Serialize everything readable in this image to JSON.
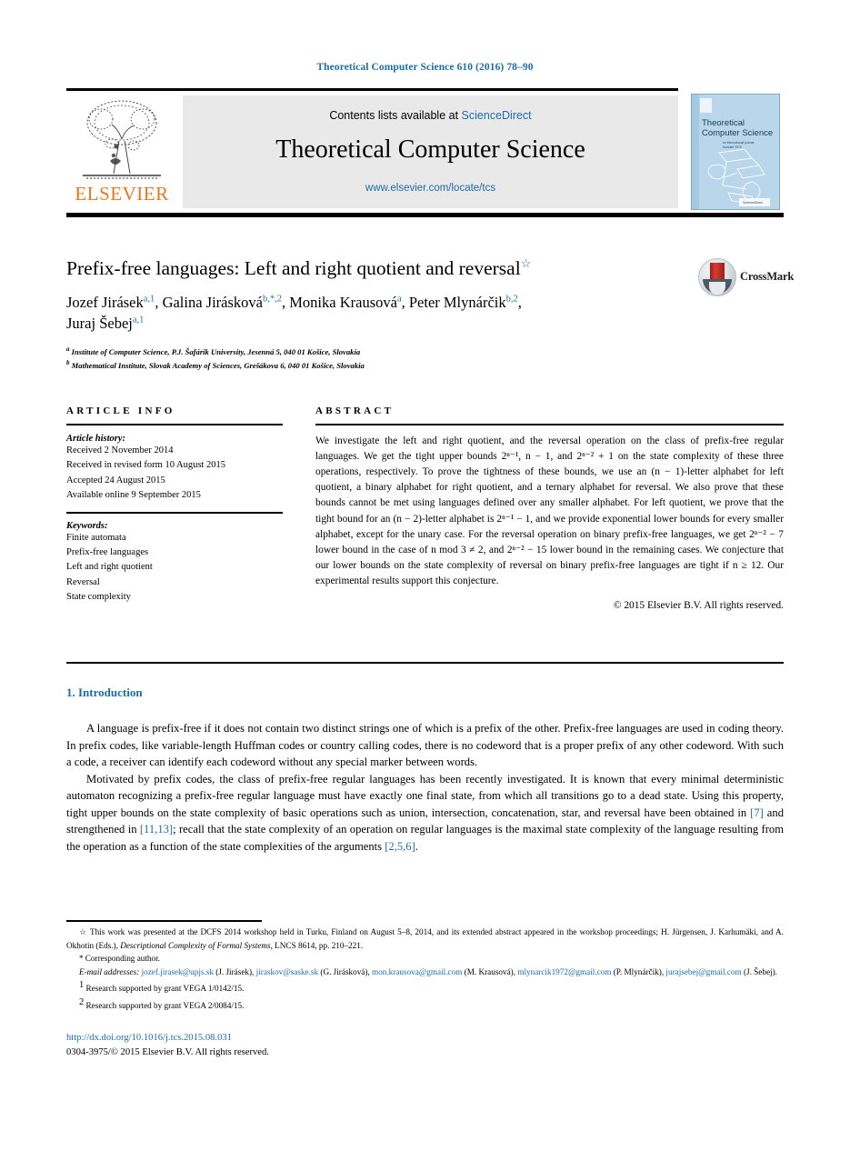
{
  "running_head": "Theoretical Computer Science 610 (2016) 78–90",
  "masthead": {
    "contents_prefix": "Contents lists available at",
    "sciencedirect": "ScienceDirect",
    "journal_title": "Theoretical Computer Science",
    "journal_url": "www.elsevier.com/locate/tcs",
    "publisher": "ELSEVIER",
    "cover_title_line1": "Theoretical",
    "cover_title_line2": "Computer Science"
  },
  "article": {
    "title": "Prefix-free languages: Left and right quotient and reversal",
    "title_star": "☆",
    "crossmark_label": "CrossMark",
    "authors_line1": "Jozef Jirásek",
    "authors": [
      {
        "name": "Jozef Jirásek",
        "sup": "a,1"
      },
      {
        "name": "Galina Jirásková",
        "sup": "b,*,2"
      },
      {
        "name": "Monika Krausová",
        "sup": "a"
      },
      {
        "name": "Peter Mlynárčik",
        "sup": "b,2"
      },
      {
        "name": "Juraj Šebej",
        "sup": "a,1"
      }
    ],
    "affiliations": [
      {
        "marker": "a",
        "text": "Institute of Computer Science, P.J. Šafárik University, Jesenná 5, 040 01 Košice, Slovakia"
      },
      {
        "marker": "b",
        "text": "Mathematical Institute, Slovak Academy of Sciences, Grešákova 6, 040 01 Košice, Slovakia"
      }
    ]
  },
  "article_info": {
    "heading": "ARTICLE INFO",
    "history_heading": "Article history:",
    "history": [
      "Received 2 November 2014",
      "Received in revised form 10 August 2015",
      "Accepted 24 August 2015",
      "Available online 9 September 2015"
    ],
    "keywords_heading": "Keywords:",
    "keywords": [
      "Finite automata",
      "Prefix-free languages",
      "Left and right quotient",
      "Reversal",
      "State complexity"
    ]
  },
  "abstract": {
    "heading": "ABSTRACT",
    "text": "We investigate the left and right quotient, and the reversal operation on the class of prefix-free regular languages. We get the tight upper bounds 2ⁿ⁻¹, n − 1, and 2ⁿ⁻² + 1 on the state complexity of these three operations, respectively. To prove the tightness of these bounds, we use an (n − 1)-letter alphabet for left quotient, a binary alphabet for right quotient, and a ternary alphabet for reversal. We also prove that these bounds cannot be met using languages defined over any smaller alphabet. For left quotient, we prove that the tight bound for an (n − 2)-letter alphabet is 2ⁿ⁻¹ − 1, and we provide exponential lower bounds for every smaller alphabet, except for the unary case. For the reversal operation on binary prefix-free languages, we get 2ⁿ⁻² − 7 lower bound in the case of n mod 3 ≠ 2, and 2ⁿ⁻² − 15 lower bound in the remaining cases. We conjecture that our lower bounds on the state complexity of reversal on binary prefix-free languages are tight if n ≥ 12. Our experimental results support this conjecture.",
    "copyright": "© 2015 Elsevier B.V. All rights reserved."
  },
  "introduction": {
    "number": "1.",
    "heading": "Introduction",
    "paragraph1": "A language is prefix-free if it does not contain two distinct strings one of which is a prefix of the other. Prefix-free languages are used in coding theory. In prefix codes, like variable-length Huffman codes or country calling codes, there is no codeword that is a proper prefix of any other codeword. With such a code, a receiver can identify each codeword without any special marker between words.",
    "paragraph2_part1": "Motivated by prefix codes, the class of prefix-free regular languages has been recently investigated. It is known that every minimal deterministic automaton recognizing a prefix-free regular language must have exactly one final state, from which all transitions go to a dead state. Using this property, tight upper bounds on the state complexity of basic operations such as union, intersection, concatenation, star, and reversal have been obtained in ",
    "ref1": "[7]",
    "paragraph2_part2": " and strengthened in ",
    "ref2": "[11,13]",
    "paragraph2_part3": "; recall that the state complexity of an operation on regular languages is the maximal state complexity of the language resulting from the operation as a function of the state complexities of the arguments ",
    "ref3": "[2,5,6]",
    "paragraph2_part4": "."
  },
  "footnotes": {
    "star_symbol": "☆",
    "star_text_part1": "This work was presented at the DCFS 2014 workshop held in Turku, Finland on August 5–8, 2014, and its extended abstract appeared in the workshop proceedings; H. Jürgensen, J. Karhumäki, and A. Okhotin (Eds.), ",
    "star_text_italic": "Descriptional Complexity of Formal Systems",
    "star_text_part2": ", LNCS 8614, pp. 210–221.",
    "corresponding_symbol": "*",
    "corresponding_text": "Corresponding author.",
    "email_label": "E-mail addresses:",
    "emails": [
      {
        "address": "jozef.jirasek@upjs.sk",
        "person": "(J. Jirásek),"
      },
      {
        "address": "jiraskov@saske.sk",
        "person": "(G. Jirásková),"
      },
      {
        "address": "mon.krausova@gmail.com",
        "person": "(M. Krausová),"
      },
      {
        "address": "mlynarcik1972@gmail.com",
        "person": "(P. Mlynárčik),"
      },
      {
        "address": "jurajsebej@gmail.com",
        "person": "(J. Šebej)."
      }
    ],
    "grants": [
      {
        "marker": "1",
        "text": "Research supported by grant VEGA 1/0142/15."
      },
      {
        "marker": "2",
        "text": "Research supported by grant VEGA 2/0084/15."
      }
    ]
  },
  "footer": {
    "doi": "http://dx.doi.org/10.1016/j.tcs.2015.08.031",
    "issn_line": "0304-3975/© 2015 Elsevier B.V. All rights reserved."
  },
  "colors": {
    "link": "#1a6fa8",
    "elsevier_orange": "#E87722",
    "band_grey": "#e9e9e9",
    "cover_blue": "#b9d6ea"
  }
}
